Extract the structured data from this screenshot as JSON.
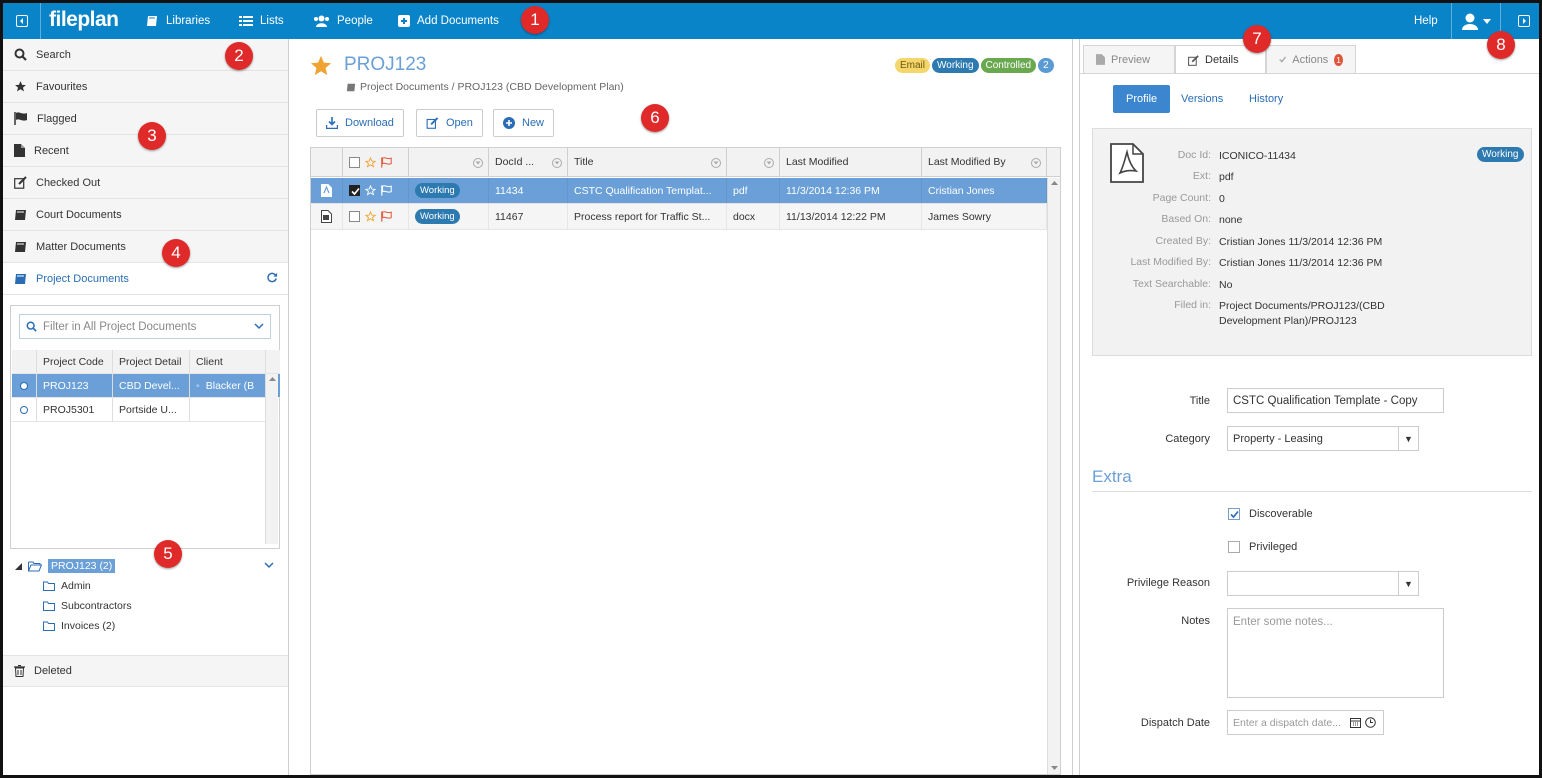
{
  "topbar": {
    "logo": "fileplan",
    "nav": [
      {
        "label": "Libraries",
        "icon": "book-icon"
      },
      {
        "label": "Lists",
        "icon": "list-icon"
      },
      {
        "label": "People",
        "icon": "people-icon"
      },
      {
        "label": "Add Documents",
        "icon": "plus-square-icon"
      }
    ],
    "help": "Help"
  },
  "callouts": [
    "1",
    "2",
    "3",
    "4",
    "5",
    "6",
    "7",
    "8"
  ],
  "sidebar": {
    "items": [
      {
        "label": "Search",
        "icon": "search-icon"
      },
      {
        "label": "Favourites",
        "icon": "star-icon"
      },
      {
        "label": "Flagged",
        "icon": "flag-icon"
      },
      {
        "label": "Recent",
        "icon": "file-icon"
      },
      {
        "label": "Checked Out",
        "icon": "edit-icon"
      },
      {
        "label": "Court Documents",
        "icon": "book-icon"
      },
      {
        "label": "Matter Documents",
        "icon": "book-icon"
      },
      {
        "label": "Project Documents",
        "icon": "book-icon"
      }
    ],
    "filter_placeholder": "Filter in All Project Documents",
    "project_columns": [
      "Project Code",
      "Project Detail",
      "Client"
    ],
    "projects": [
      {
        "code": "PROJ123",
        "detail": "CBD Devel...",
        "client": "Blacker (B"
      },
      {
        "code": "PROJ5301",
        "detail": "Portside U...",
        "client": ""
      }
    ],
    "tree": {
      "root": "PROJ123 (2)",
      "children": [
        "Admin",
        "Subcontractors",
        "Invoices (2)"
      ]
    },
    "deleted": "Deleted"
  },
  "main": {
    "title": "PROJ123",
    "breadcrumb": "Project Documents / PROJ123 (CBD Development Plan)",
    "badges": [
      {
        "label": "Email",
        "color": "#f5d66b",
        "text_color": "#6b5a10"
      },
      {
        "label": "Working",
        "color": "#2d7ab0",
        "text_color": "#ffffff"
      },
      {
        "label": "Controlled",
        "color": "#6aa84f",
        "text_color": "#ffffff"
      },
      {
        "label": "2",
        "color": "#5b9bd5",
        "text_color": "#ffffff"
      }
    ],
    "buttons": {
      "download": "Download",
      "open": "Open",
      "new": "New"
    },
    "columns": [
      "DocId ...",
      "Title",
      "Last Modified",
      "Last Modified By"
    ],
    "rows": [
      {
        "status": "Working",
        "docid": "11434",
        "title": "CSTC Qualification Templat...",
        "ext": "pdf",
        "modified": "11/3/2014 12:36 PM",
        "by": "Cristian Jones",
        "selected": true
      },
      {
        "status": "Working",
        "docid": "11467",
        "title": "Process report for Traffic St...",
        "ext": "docx",
        "modified": "11/13/2014 12:22 PM",
        "by": "James Sowry",
        "selected": false
      }
    ]
  },
  "right": {
    "tabs": {
      "preview": "Preview",
      "details": "Details",
      "actions": "Actions",
      "actions_count": "1"
    },
    "subtabs": [
      "Profile",
      "Versions",
      "History"
    ],
    "status": "Working",
    "fields": [
      {
        "k": "Doc Id:",
        "v": "ICONICO-11434"
      },
      {
        "k": "Ext:",
        "v": "pdf"
      },
      {
        "k": "Page Count:",
        "v": "0"
      },
      {
        "k": "Based On:",
        "v": "none"
      },
      {
        "k": "Created By:",
        "v": "Cristian Jones 11/3/2014 12:36 PM"
      },
      {
        "k": "Last Modified By:",
        "v": "Cristian Jones 11/3/2014 12:36 PM"
      },
      {
        "k": "Text Searchable:",
        "v": "No"
      },
      {
        "k": "Filed in:",
        "v": "Project Documents/PROJ123/(CBD Development Plan)/PROJ123"
      }
    ],
    "form": {
      "title_label": "Title",
      "title_value": "CSTC Qualification Template - Copy",
      "category_label": "Category",
      "category_value": "Property - Leasing",
      "extra_heading": "Extra",
      "discoverable": "Discoverable",
      "privileged": "Privileged",
      "privilege_reason_label": "Privilege Reason",
      "notes_label": "Notes",
      "notes_placeholder": "Enter some notes...",
      "dispatch_label": "Dispatch Date",
      "dispatch_placeholder": "Enter a dispatch date..."
    }
  }
}
